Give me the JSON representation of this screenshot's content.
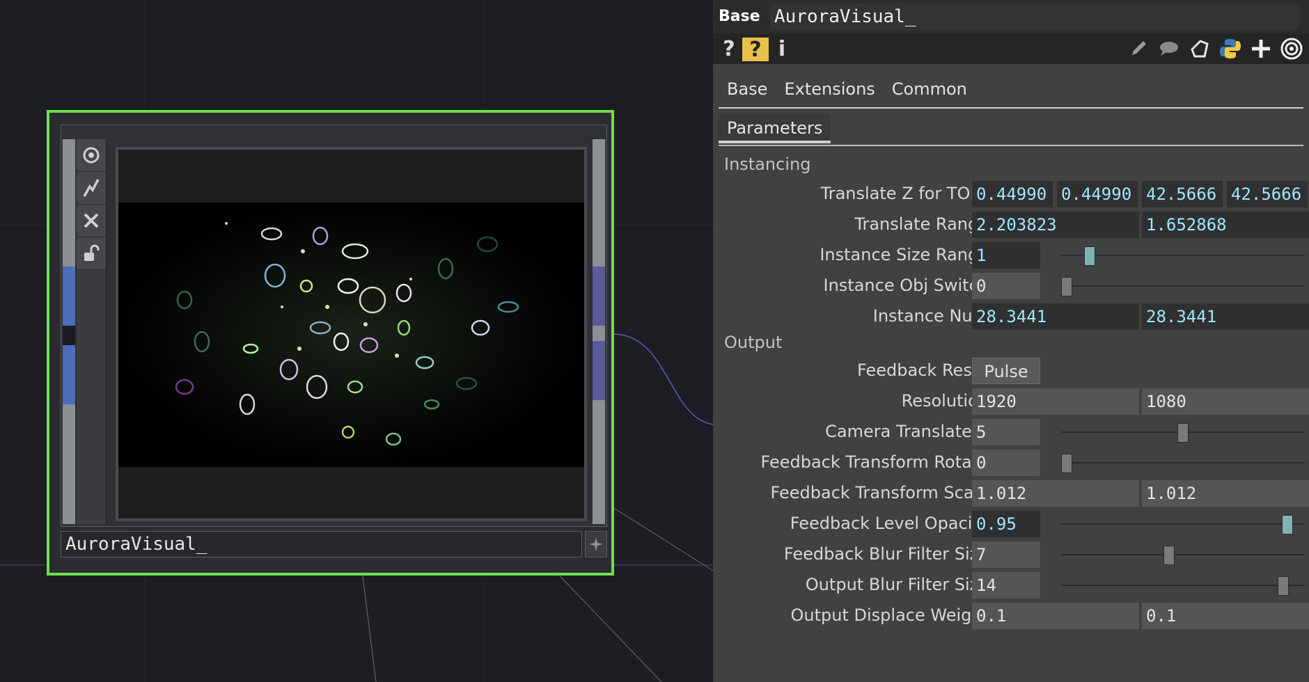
{
  "node": {
    "name": "AuroraVisual_",
    "side_buttons": [
      {
        "icon": "viewer-target-icon"
      },
      {
        "icon": "bypass-lightning-icon"
      },
      {
        "icon": "close-x-icon"
      },
      {
        "icon": "lock-icon"
      }
    ],
    "pin_icon": "pin-icon"
  },
  "panel": {
    "header": {
      "type": "Base",
      "name": "AuroraVisual_"
    },
    "toolbar": {
      "left": [
        {
          "icon": "help-icon",
          "glyph": "?"
        },
        {
          "icon": "help-python-icon",
          "glyph": "?"
        },
        {
          "icon": "info-icon",
          "glyph": "i"
        }
      ],
      "right": [
        {
          "icon": "edit-pencil-icon"
        },
        {
          "icon": "comment-bubble-icon"
        },
        {
          "icon": "tag-icon"
        },
        {
          "icon": "python-icon"
        },
        {
          "icon": "add-plus-icon"
        },
        {
          "icon": "viewer-target-icon"
        }
      ]
    },
    "tabs": [
      "Base",
      "Extensions",
      "Common"
    ],
    "subtab": "Parameters",
    "sections": {
      "instancing": "Instancing",
      "output": "Output"
    },
    "params": {
      "translate_z": {
        "label": "Translate Z for TOPs",
        "values": [
          "0.44990",
          "0.44990",
          "42.5666",
          "42.5666"
        ]
      },
      "translate_range": {
        "label": "Translate Range",
        "values": [
          "2.203823",
          "1.652868"
        ]
      },
      "instance_size_range": {
        "label": "Instance Size Range",
        "value": "1",
        "slider": 0.1
      },
      "instance_obj_switch": {
        "label": "Instance Obj Switch",
        "value": "0",
        "slider": 0.0
      },
      "instance_num": {
        "label": "Instance Num",
        "values": [
          "28.3441",
          "28.3441"
        ]
      },
      "feedback_reset": {
        "label": "Feedback Reset",
        "button": "Pulse"
      },
      "resolution": {
        "label": "Resolution",
        "values": [
          "1920",
          "1080"
        ]
      },
      "camera_translate_z": {
        "label": "Camera Translate Z",
        "value": "5",
        "slider": 0.5
      },
      "feedback_transform_rotate": {
        "label": "Feedback Transform Rotate",
        "value": "0",
        "slider": 0.0
      },
      "feedback_transform_scale": {
        "label": "Feedback Transform Scale",
        "values": [
          "1.012",
          "1.012"
        ]
      },
      "feedback_level_opacity": {
        "label": "Feedback Level Opacity",
        "value": "0.95",
        "slider": 0.95
      },
      "feedback_blur_filter_size": {
        "label": "Feedback Blur Filter Size",
        "value": "7",
        "slider": 0.44
      },
      "output_blur_filter_size": {
        "label": "Output Blur Filter Size",
        "value": "14",
        "slider": 0.93
      },
      "output_displace_weight": {
        "label": "Output Displace Weight",
        "values": [
          "0.1",
          "0.1"
        ]
      }
    }
  },
  "colors": {
    "node_selected_border": "#6ce04e",
    "value_text": "#9fe7ff",
    "panel_bg": "#414141"
  }
}
